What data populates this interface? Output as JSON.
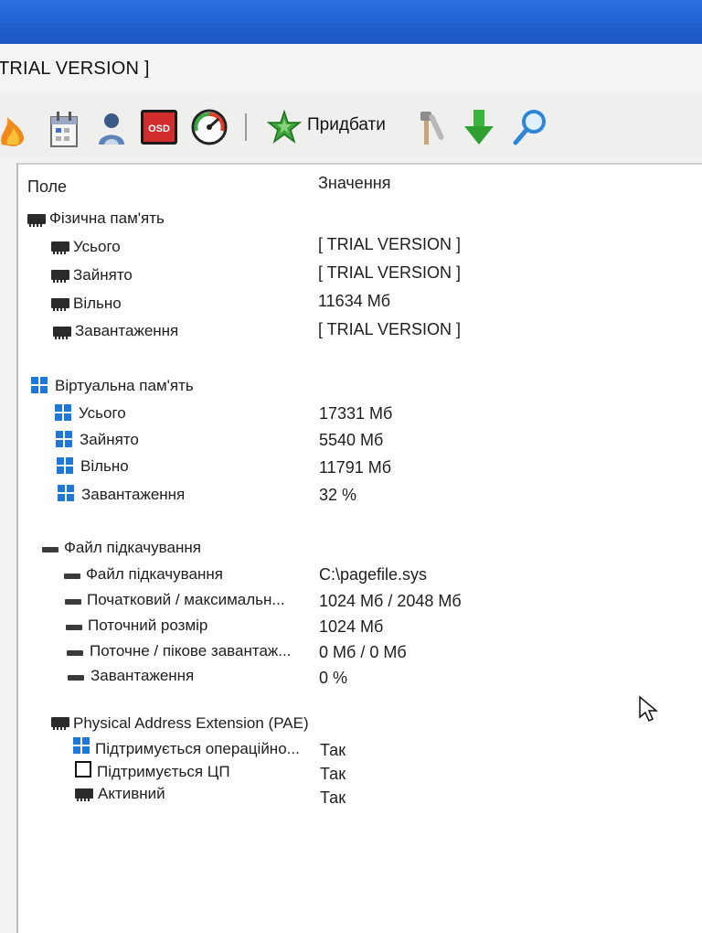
{
  "window": {
    "title": "TRIAL VERSION ]"
  },
  "toolbar": {
    "add_label": "Придбати",
    "icons": [
      "flame-icon",
      "calendar-icon",
      "user-icon",
      "osd-icon",
      "gauge-icon",
      "add-star-icon",
      "tools-icon",
      "download-arrow-icon",
      "search-icon"
    ],
    "osd_text": "OSD"
  },
  "columns": {
    "field": "Поле",
    "value": "Значення"
  },
  "physical": {
    "label": "Фізична пам'ять",
    "rows": [
      {
        "label": "Усього",
        "value": "[ TRIAL VERSION ]"
      },
      {
        "label": "Зайнято",
        "value": "[ TRIAL VERSION ]"
      },
      {
        "label": "Вільно",
        "value": "11634 Мб"
      },
      {
        "label": "Завантаження",
        "value": "[ TRIAL VERSION ]"
      }
    ]
  },
  "virtual": {
    "label": "Віртуальна пам'ять",
    "rows": [
      {
        "label": "Усього",
        "value": "17331 Мб"
      },
      {
        "label": "Зайнято",
        "value": "5540 Мб"
      },
      {
        "label": "Вільно",
        "value": "11791 Мб"
      },
      {
        "label": "Завантаження",
        "value": "32 %"
      }
    ]
  },
  "pagefile": {
    "label": "Файл підкачування",
    "rows": [
      {
        "label": "Файл підкачування",
        "value": "C:\\pagefile.sys"
      },
      {
        "label": "Початковий / максимальн...",
        "value": "1024 Мб / 2048 Мб"
      },
      {
        "label": "Поточний розмір",
        "value": "1024 Мб"
      },
      {
        "label": "Поточне / пікове завантаж...",
        "value": "0 Мб / 0 Мб"
      },
      {
        "label": "Завантаження",
        "value": "0 %"
      }
    ]
  },
  "pae": {
    "label": "Physical Address Extension (PAE)",
    "rows": [
      {
        "label": "Підтримується операційно...",
        "value": "Так"
      },
      {
        "label": "Підтримується ЦП",
        "value": "Так"
      },
      {
        "label": "Активний",
        "value": "Так"
      }
    ]
  },
  "colors": {
    "titlebar": "#1f63d6",
    "win_blue": "#1e78d8",
    "accent_green": "#2fa83a"
  }
}
